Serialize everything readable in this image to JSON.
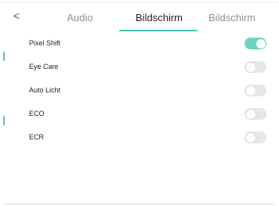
{
  "header": {
    "back_glyph": "<",
    "tabs": [
      {
        "label": "Audio",
        "active": false
      },
      {
        "label": "Bildschirm",
        "active": true
      },
      {
        "label": "Bildschirm",
        "active": false
      }
    ]
  },
  "settings": [
    {
      "label": "Pixel Shift",
      "enabled": true
    },
    {
      "label": "Eye Care",
      "enabled": false
    },
    {
      "label": "Auto Licht",
      "enabled": false
    },
    {
      "label": "ECO",
      "enabled": false
    },
    {
      "label": "ECR",
      "enabled": false
    }
  ],
  "colors": {
    "accent": "#45c7b4",
    "toggle_on": "#6fd3bf",
    "toggle_off": "#e6e6ea"
  }
}
